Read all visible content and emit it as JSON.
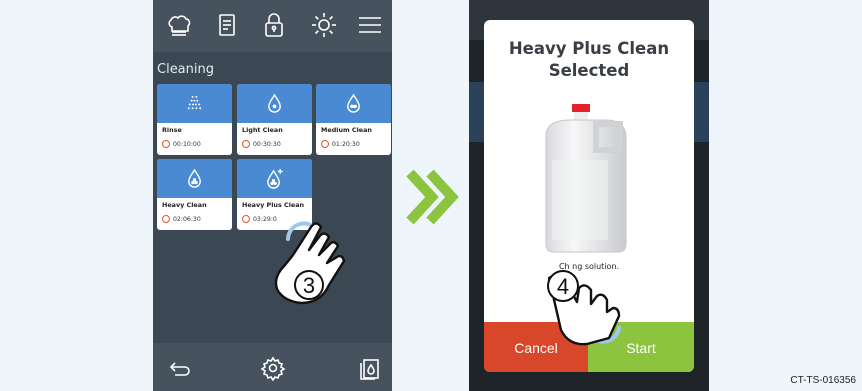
{
  "left_screen": {
    "top_icons": [
      "chef-hat-icon",
      "recipe-book-icon",
      "lock-icon",
      "brightness-icon",
      "menu-icon"
    ],
    "section_title": "Cleaning",
    "programs": [
      {
        "name": "Rinse",
        "time": "00:10:00",
        "icon": "shower-icon"
      },
      {
        "name": "Light Clean",
        "time": "00:30:30",
        "icon": "drop-icon"
      },
      {
        "name": "Medium Clean",
        "time": "01:20:30",
        "icon": "drop-icon"
      },
      {
        "name": "Heavy Clean",
        "time": "02:06:30",
        "icon": "drop-icon"
      },
      {
        "name": "Heavy Plus Clean",
        "time": "03:29:0",
        "icon": "drop-plus-icon"
      }
    ],
    "bottom_icons": [
      "back-icon",
      "settings-icon",
      "cleaner-bottle-icon"
    ],
    "step_number": "3"
  },
  "right_screen": {
    "dialog_title_line1": "Heavy Plus Clean",
    "dialog_title_line2": "Selected",
    "message": "Ch                ng solution.",
    "cancel_label": "Cancel",
    "start_label": "Start",
    "step_number": "4"
  },
  "reference_code": "CT-TS-016356",
  "colors": {
    "tile_header": "#4a8ad3",
    "cancel": "#d9472b",
    "start": "#8cc43f",
    "arrow": "#8cc43f",
    "clock": "#e0542f"
  }
}
